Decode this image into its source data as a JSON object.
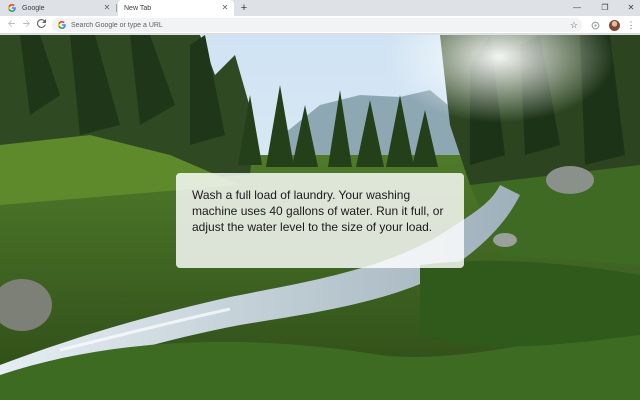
{
  "tabs": [
    {
      "title": "Google",
      "active": false
    },
    {
      "title": "New Tab",
      "active": true
    }
  ],
  "toolbar": {
    "omnibox_placeholder": "Search Google or type a URL"
  },
  "icons": {
    "back": "arrow-left-icon",
    "forward": "arrow-right-icon",
    "reload": "reload-icon",
    "new_tab": "plus-icon",
    "bookmark": "star-icon",
    "menu": "more-vert-icon"
  },
  "colors": {
    "tabstrip": "#dee1e6",
    "toolbar": "#ffffff",
    "omnibox": "#f1f3f4"
  },
  "message": {
    "text": "Wash a full load of laundry. Your washing machine uses 40 gallons of water. Run it full, or adjust the water level to the size of your load."
  }
}
